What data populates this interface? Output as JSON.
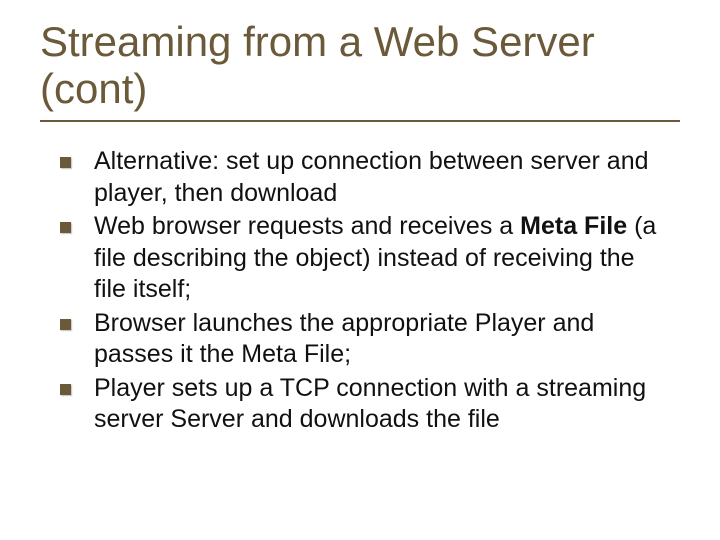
{
  "slide": {
    "title": "Streaming from a Web Server (cont)",
    "bullets": [
      {
        "pre": "Alternative: set up connection between server and player, then download",
        "bold": "",
        "post": ""
      },
      {
        "pre": "Web browser requests and receives a ",
        "bold": "Meta File",
        "post": " (a file describing the object) instead of receiving the file itself;"
      },
      {
        "pre": "Browser launches the appropriate Player and passes it the Meta File;",
        "bold": "",
        "post": ""
      },
      {
        "pre": "Player sets up a TCP connection with a streaming server Server and downloads the file",
        "bold": "",
        "post": ""
      }
    ]
  }
}
